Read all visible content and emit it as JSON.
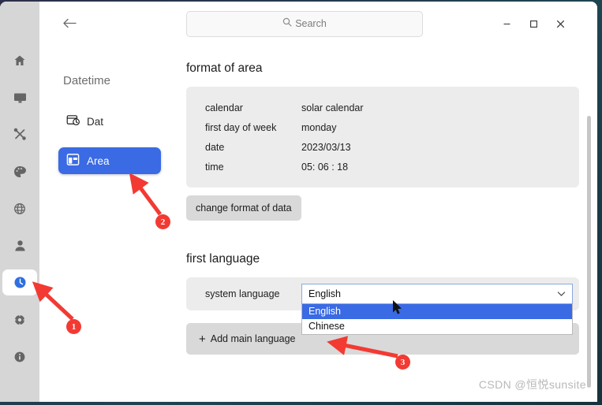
{
  "window": {
    "back_icon": "arrow-left-icon",
    "controls": {
      "minimize": "–",
      "maximize": "□",
      "close": "✕"
    }
  },
  "search": {
    "placeholder": "Search",
    "icon": "search-icon"
  },
  "rail": {
    "items": [
      {
        "name": "home",
        "icon": "home-icon",
        "active": false
      },
      {
        "name": "display",
        "icon": "monitor-icon",
        "active": false
      },
      {
        "name": "tools",
        "icon": "tools-icon",
        "active": false
      },
      {
        "name": "personalization",
        "icon": "palette-icon",
        "active": false
      },
      {
        "name": "network",
        "icon": "globe-icon",
        "active": false
      },
      {
        "name": "account",
        "icon": "user-icon",
        "active": false
      },
      {
        "name": "datetime",
        "icon": "clock-icon",
        "active": true
      },
      {
        "name": "update",
        "icon": "crosshair-icon",
        "active": false
      },
      {
        "name": "about",
        "icon": "info-icon",
        "active": false
      }
    ]
  },
  "nav": {
    "title": "Datetime",
    "items": [
      {
        "label": "Dat",
        "icon": "calendar-clock-icon",
        "selected": false
      },
      {
        "label": "Area",
        "icon": "layout-icon",
        "selected": true
      }
    ]
  },
  "format_section": {
    "title": "format of area",
    "rows": [
      {
        "label": "calendar",
        "value": "solar calendar"
      },
      {
        "label": "first day of week",
        "value": "monday"
      },
      {
        "label": "date",
        "value": "2023/03/13"
      },
      {
        "label": "time",
        "value": "05: 06 : 18"
      }
    ],
    "button_label": "change format of data"
  },
  "language_section": {
    "title": "first language",
    "row_label": "system language",
    "selected_value": "English",
    "dropdown_open": true,
    "options": [
      {
        "label": "English",
        "highlighted": true
      },
      {
        "label": "Chinese",
        "highlighted": false
      }
    ],
    "chevron_icon": "chevron-down-icon",
    "add_language_label": "Add main language",
    "add_icon": "plus-icon"
  },
  "annotations": {
    "markers": [
      {
        "id": "1",
        "label": "1"
      },
      {
        "id": "2",
        "label": "2"
      },
      {
        "id": "3",
        "label": "3"
      }
    ]
  },
  "watermark": {
    "text": "CSDN @恒悦sunsite"
  },
  "colors": {
    "accent_blue": "#3a6ae4",
    "marker_red": "#f23a33",
    "panel_gray": "#ececec",
    "button_gray": "#d9d9d9",
    "rail_gray": "#d6d6d6"
  }
}
